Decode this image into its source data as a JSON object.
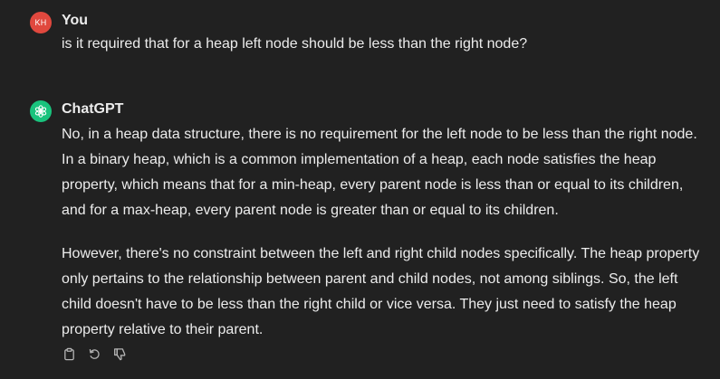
{
  "conversation": {
    "user_message": {
      "avatar_initials": "KH",
      "avatar_color": "#e0483e",
      "author": "You",
      "text": "is it required that for a heap left node should be less than the right node?"
    },
    "assistant_message": {
      "avatar_icon": "openai-logo-icon",
      "avatar_color": "#19c37d",
      "author": "ChatGPT",
      "paragraphs": [
        "No, in a heap data structure, there is no requirement for the left node to be less than the right node. In a binary heap, which is a common implementation of a heap, each node satisfies the heap property, which means that for a min-heap, every parent node is less than or equal to its children, and for a max-heap, every parent node is greater than or equal to its children.",
        "However, there's no constraint between the left and right child nodes specifically. The heap property only pertains to the relationship between parent and child nodes, not among siblings. So, the left child doesn't have to be less than the right child or vice versa. They just need to satisfy the heap property relative to their parent."
      ]
    },
    "actions": [
      {
        "name": "copy-icon"
      },
      {
        "name": "regenerate-icon"
      },
      {
        "name": "thumbs-down-icon"
      }
    ]
  },
  "theme": {
    "background": "#212121",
    "text": "#ececec",
    "icon": "#b4b4b4"
  }
}
